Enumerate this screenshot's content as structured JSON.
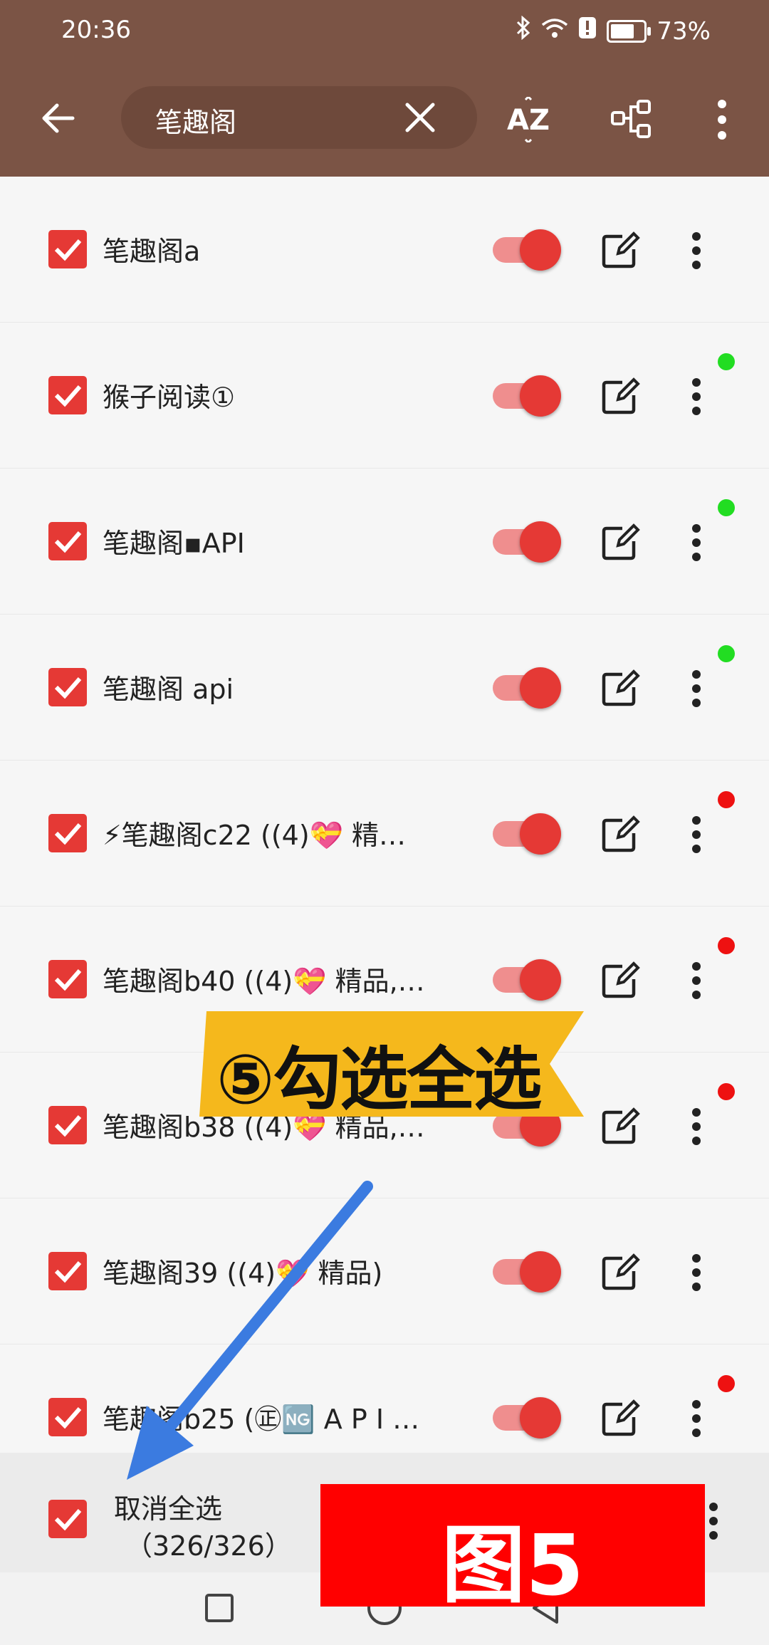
{
  "status": {
    "time": "20:36",
    "battery": "73%",
    "battery_level": 0.73
  },
  "search": {
    "query": "笔趣阁"
  },
  "toolbar": {
    "sort_icon_text": "AZ"
  },
  "rows": [
    {
      "label": "笔趣阁a",
      "checked": true,
      "enabled": true,
      "dot": null
    },
    {
      "label": "猴子阅读①",
      "checked": true,
      "enabled": true,
      "dot": "#22dd22"
    },
    {
      "label": "笔趣阁▪API",
      "checked": true,
      "enabled": true,
      "dot": "#22dd22"
    },
    {
      "label": "笔趣阁 api",
      "checked": true,
      "enabled": true,
      "dot": "#22dd22"
    },
    {
      "label": "⚡笔趣阁c22 ((4)💝  精…",
      "checked": true,
      "enabled": true,
      "dot": "#ee1111"
    },
    {
      "label": "笔趣阁b40 ((4)💝  精品,…",
      "checked": true,
      "enabled": true,
      "dot": "#ee1111"
    },
    {
      "label": "笔趣阁b38 ((4)💝  精品,…",
      "checked": true,
      "enabled": true,
      "dot": "#ee1111"
    },
    {
      "label": "笔趣阁39 ((4)💝  精品)",
      "checked": true,
      "enabled": true,
      "dot": null
    },
    {
      "label": "笔趣阁b25 (㊣🆖  A P I …",
      "checked": true,
      "enabled": true,
      "dot": "#ee1111"
    }
  ],
  "bottom": {
    "select_label": "取消全选",
    "count": "（326/326）"
  },
  "overlay": {
    "banner": "⑤勾选全选",
    "figure_label": "图5"
  },
  "colors": {
    "accent": "#e53935",
    "toolbar": "#7b5445",
    "banner": "#f5b81c",
    "arrow": "#3b7be0"
  }
}
